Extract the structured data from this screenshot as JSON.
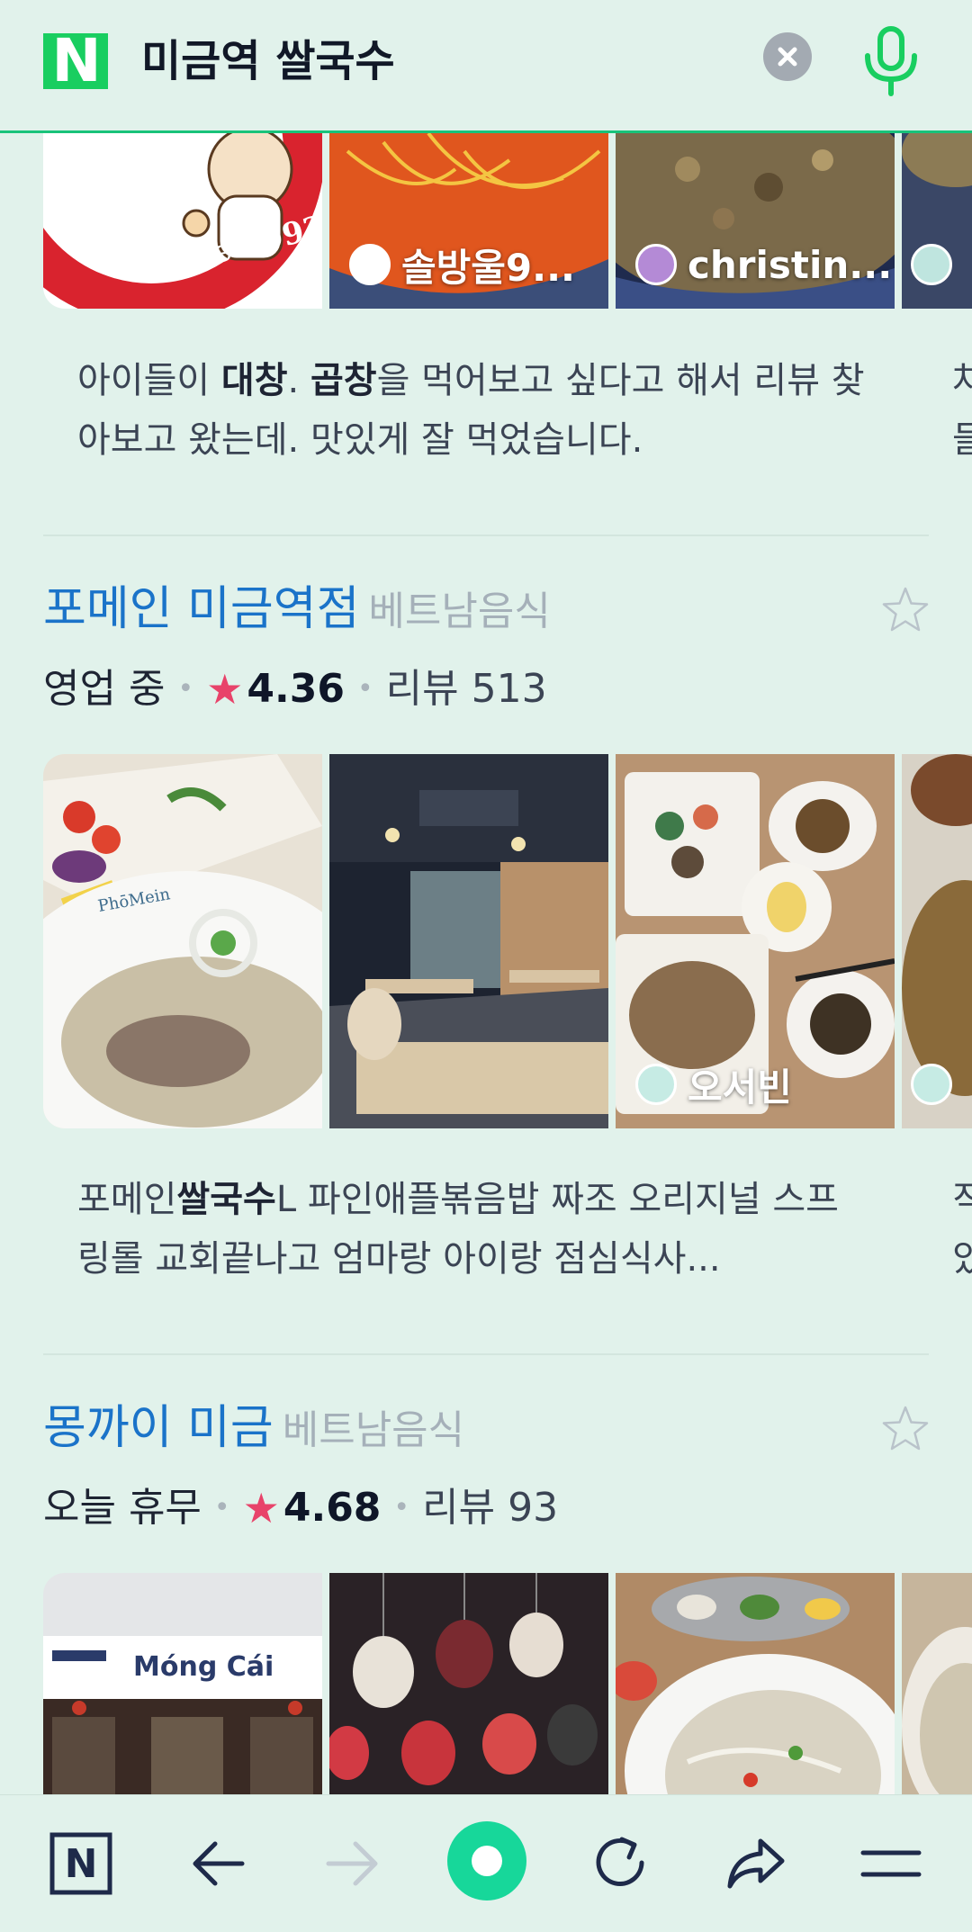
{
  "search": {
    "logo": "N",
    "query": "미금역 쌀국수"
  },
  "prev_place": {
    "photos": [
      {
        "user": ""
      },
      {
        "user": "솔방울9..."
      },
      {
        "user": "christin..."
      },
      {
        "user": ""
      }
    ],
    "review_parts": [
      "아이들이 ",
      "대창",
      ". ",
      "곱창",
      "을 먹어보고 싶다고 해서 리뷰 찾아보고 왔는데. 맛있게 잘 먹었습니다."
    ],
    "peek_lines": [
      "차",
      "들"
    ]
  },
  "places": [
    {
      "name": "포메인 미금역점",
      "category": "베트남음식",
      "status": "영업 중",
      "rating": "4.36",
      "reviews": "리뷰 513",
      "photos": [
        {
          "user": ""
        },
        {
          "user": ""
        },
        {
          "user": "오서빈"
        },
        {
          "user": ""
        }
      ],
      "review_parts": [
        "포메인",
        "쌀국수",
        "L 파인애플볶음밥 짜조 오리지널 스프링롤 교회끝나고 엄마랑 아이랑 점심식사..."
      ],
      "peek_lines": [
        "직",
        "있"
      ]
    },
    {
      "name": "몽까이 미금",
      "category": "베트남음식",
      "status": "오늘 휴무",
      "rating": "4.68",
      "reviews": "리뷰 93",
      "photos": [
        {
          "sign": "Móng Cái"
        },
        {
          "user": ""
        },
        {
          "user": ""
        },
        {
          "user": ""
        }
      ]
    }
  ],
  "colors": {
    "accent_green": "#19ce60",
    "place_name_blue": "#1a73c9",
    "rating_star": "#e8436a"
  },
  "toolbar": {
    "home_logo": "N",
    "icons": [
      "naver-home-icon",
      "back-arrow-icon",
      "forward-arrow-icon",
      "green-dot-icon",
      "refresh-icon",
      "share-icon",
      "menu-icon"
    ]
  }
}
